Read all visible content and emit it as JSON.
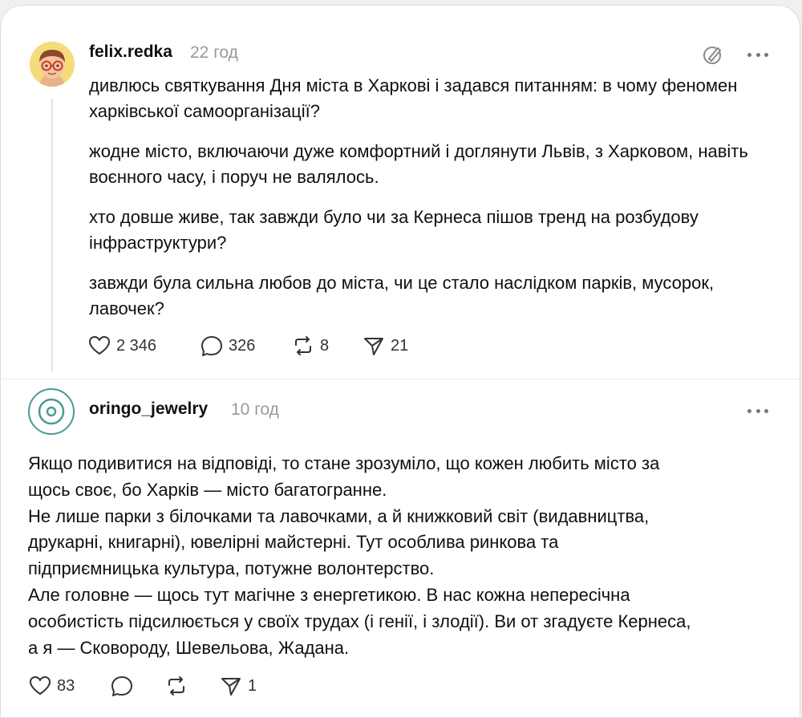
{
  "posts": [
    {
      "username": "felix.redka",
      "time": "22 год",
      "paragraphs": [
        "дивлюсь святкування Дня міста в Харкові і задався питанням: в чому феномен харківської самоорганізації?",
        "жодне місто, включаючи дуже комфортний і доглянути Львів, з Харковом, навіть воєнного часу, і поруч не валялось.",
        "хто довше живе, так завжди було чи за Кернеса пішов тренд на розбудову інфраструктури?",
        "завжди була сильна любов до міста, чи це стало наслідком парків, мусорок, лавочек?"
      ],
      "likes": "2 346",
      "comments": "326",
      "reposts": "8",
      "shares": "21",
      "avatar_icon": "cartoon-avatar-with-glasses"
    },
    {
      "username": "oringo_jewelry",
      "time": "10 год",
      "text_lines": [
        "Якщо подивитися на відповіді, то стане зрозуміло, що кожен любить місто за",
        "щось своє, бо Харків — місто багатогранне.",
        "Не лише парки з білочками та лавочками, а й книжковий світ (видавництва,",
        "друкарні, книгарні), ювелірні майстерні. Тут особлива ринкова та",
        "підприємницька культура, потужне волонтерство.",
        "Але головне — щось тут магічне з енергетикою. В нас кожна непересічна",
        "особистість підсилюється у своїх трудах (і генії, і злодії). Ви от згадуєте Кернеса,",
        "а я — Сковороду, Шевельова, Жадана."
      ],
      "likes": "83",
      "comments": "",
      "reposts": "",
      "shares": "1",
      "avatar_icon": "ring-logo"
    }
  ],
  "colors": {
    "text": "#101010",
    "muted": "#9a9a9a",
    "brand_teal": "#4a9a94",
    "avatar_yellow": "#f5dc7a"
  }
}
